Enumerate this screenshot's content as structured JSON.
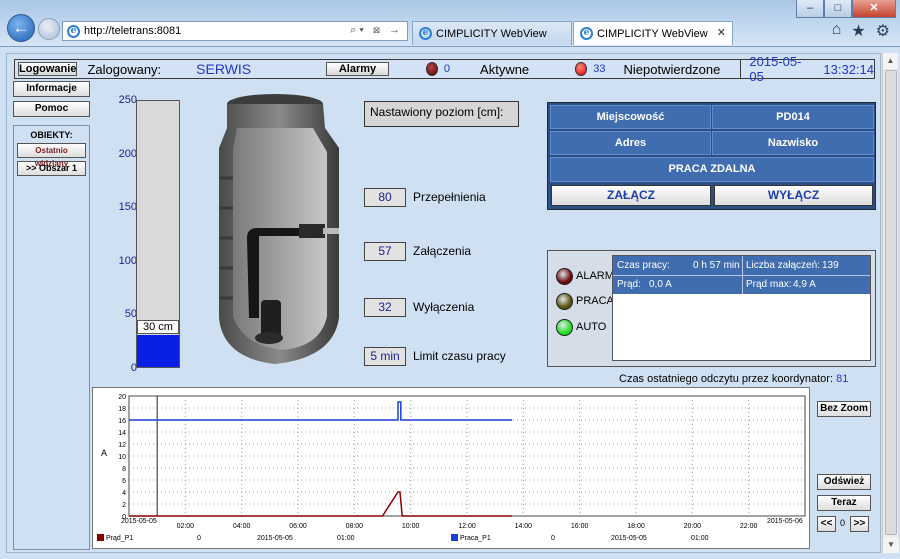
{
  "browser": {
    "url": "http://teletrans:8081",
    "tabs": [
      {
        "title": "CIMPLICITY WebView",
        "active": false
      },
      {
        "title": "CIMPLICITY WebView",
        "active": true
      }
    ]
  },
  "statusbar": {
    "login_button": "Logowanie",
    "logged_label": "Zalogowany:",
    "user": "SERWIS",
    "alarms_button": "Alarmy",
    "active_count": "0",
    "active_label": "Aktywne",
    "unconfirmed_count": "33",
    "unconfirmed_label": "Niepotwierdzone",
    "date": "2015-05-05",
    "time": "13:32:14"
  },
  "nav": {
    "info_button": "Informacje",
    "help_button": "Pomoc",
    "objects_title": "OBIEKTY:",
    "last_seen_button": "Ostatnio widziany",
    "area_button": ">> Obszar 1"
  },
  "gauge": {
    "ticks": [
      "250",
      "200",
      "150",
      "100",
      "50",
      "0"
    ],
    "max": 250,
    "level_cm": 30,
    "level_label": "30 cm"
  },
  "settings": {
    "title": "Nastawiony poziom [cm]:",
    "items": [
      {
        "value": "80",
        "label": "Przepełnienia"
      },
      {
        "value": "57",
        "label": "Załączenia"
      },
      {
        "value": "32",
        "label": "Wyłączenia"
      },
      {
        "value": "5  min",
        "label": "Limit czasu pracy"
      }
    ]
  },
  "info": {
    "locality_label": "Miejscowość",
    "locality_value": "PD014",
    "address_label": "Adres",
    "name_label": "Nazwisko",
    "mode": "PRACA ZDALNA",
    "on_button": "ZAŁĄCZ",
    "off_button": "WYŁĄCZ"
  },
  "pump": {
    "lamps": [
      {
        "label": "ALARM",
        "color": "#6b0a0a"
      },
      {
        "label": "PRACA",
        "color": "#5a5208"
      },
      {
        "label": "AUTO",
        "color": "#1fe01f"
      }
    ],
    "work_time_label": "Czas pracy:",
    "work_time_value": "0 h 57 min",
    "switch_count_label": "Liczba załączeń:",
    "switch_count_value": "139",
    "current_label": "Prąd:",
    "current_value": "0,0 A",
    "max_current_label": "Prąd max:",
    "max_current_value": "4,9 A"
  },
  "last_read": {
    "label": "Czas ostatniego odczytu przez koordynator:",
    "value": "81"
  },
  "chart_buttons": {
    "zoom_reset": "Bez Zoom",
    "refresh": "Odśwież",
    "now": "Teraz",
    "prev": "<<",
    "page": "0",
    "next": ">>"
  },
  "chart_data": {
    "type": "line",
    "ylabel": "A",
    "ylim": [
      0,
      20
    ],
    "yticks": [
      0,
      2,
      4,
      6,
      8,
      10,
      12,
      14,
      16,
      18,
      20
    ],
    "xlim": [
      0,
      24
    ],
    "xtick_labels": [
      "02:00",
      "04:00",
      "06:00",
      "08:00",
      "10:00",
      "12:00",
      "14:00",
      "16:00",
      "18:00",
      "20:00",
      "22:00"
    ],
    "xtick_hours": [
      2,
      4,
      6,
      8,
      10,
      12,
      14,
      16,
      18,
      20,
      22
    ],
    "x_start_label": "2015-05-05",
    "x_end_label": "2015-05-06",
    "cursor_hour": 1.0,
    "grid": true,
    "series": [
      {
        "name": "Prąd_P1",
        "color": "#8b0000",
        "legend_date": "2015-05-05",
        "legend_time": "01:00",
        "legend_value": "0",
        "x": [
          0,
          9.0,
          9.55,
          9.62,
          9.7,
          13.6
        ],
        "y": [
          0,
          0,
          4,
          4,
          0,
          0
        ]
      },
      {
        "name": "Praca_P1",
        "color": "#1a3fd6",
        "legend_date": "2015-05-05",
        "legend_time": "01:00",
        "legend_value": "0",
        "x": [
          0,
          9.55,
          9.55,
          9.65,
          9.65,
          13.6
        ],
        "y": [
          16,
          16,
          19,
          19,
          16,
          16
        ]
      }
    ]
  }
}
